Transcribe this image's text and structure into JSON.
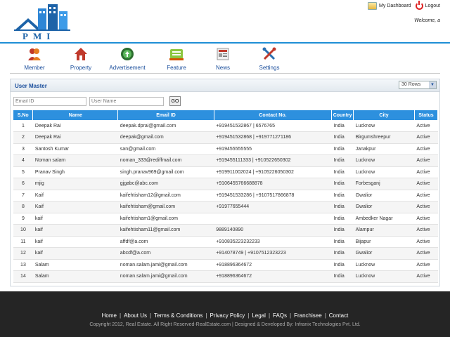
{
  "header": {
    "logo_text": "PMI",
    "dashboard_label": "My Dashboard",
    "logout_label": "Logout",
    "welcome_text": "Welcome, a"
  },
  "nav": [
    {
      "label": "Member",
      "icon": "member-icon"
    },
    {
      "label": "Property",
      "icon": "home-icon"
    },
    {
      "label": "Advertisement",
      "icon": "advertisement-icon"
    },
    {
      "label": "Feature",
      "icon": "feature-icon"
    },
    {
      "label": "News",
      "icon": "news-icon"
    },
    {
      "label": "Settings",
      "icon": "settings-icon"
    }
  ],
  "panel": {
    "title": "User Master",
    "rows_select": "30 Rows",
    "email_placeholder": "Email ID",
    "username_placeholder": "User Name",
    "go_label": "GO"
  },
  "table": {
    "headers": [
      "S.No",
      "Name",
      "Email ID",
      "Contact No.",
      "Country",
      "City",
      "Status"
    ],
    "rows": [
      [
        "1",
        "Deepak Rai",
        "deepak.dprai@gmail.com",
        "+919451532867  |  6576765",
        "India",
        "Lucknow",
        "Active"
      ],
      [
        "2",
        "Deepak Rai",
        "deepak@gmail.com",
        "+919451532868  |  +919771271186",
        "India",
        "Birgumshreepur",
        "Active"
      ],
      [
        "3",
        "Santosh Kumar",
        "san@gmail.com",
        "+919455555555",
        "India",
        "Janakpur",
        "Active"
      ],
      [
        "4",
        "Noman salam",
        "noman_333@rediffmail.com",
        "+919455111333  |  +910522650302",
        "India",
        "Lucknow",
        "Active"
      ],
      [
        "5",
        "Pranav Singh",
        "singh.pranav969@gmail.com",
        "+919911002024  |  +9105226050302",
        "India",
        "Lucknow",
        "Active"
      ],
      [
        "6",
        "mjig",
        "gjgabc@abc.com",
        "+9106455766688878",
        "India",
        "Forbesganj",
        "Active"
      ],
      [
        "7",
        "Kaif",
        "kaifehtisham12@gmail.com",
        "+919451533286  |  +9107517866878",
        "India",
        "Gwalior",
        "Active"
      ],
      [
        "8",
        "Kaif",
        "kaifehtisham@gmail.com",
        "+91977655444",
        "India",
        "Gwalior",
        "Active"
      ],
      [
        "9",
        "kaif",
        "kaifehtisham1@gmail.com",
        "",
        "India",
        "Ambedker Nagar",
        "Active"
      ],
      [
        "10",
        "kaif",
        "kaifehtisham11@gmail.com",
        "9889140890",
        "India",
        "Alampur",
        "Active"
      ],
      [
        "11",
        "kaif",
        "affdf@a.com",
        "+910835223232233",
        "India",
        "Bijapur",
        "Active"
      ],
      [
        "12",
        "kaif",
        "abcdf@a.com",
        "+914078749  |  +9107512323223",
        "India",
        "Gwalior",
        "Active"
      ],
      [
        "13",
        "Salam",
        "noman.salam.jami@gmail.com",
        "+918896364672",
        "India",
        "Lucknow",
        "Active"
      ],
      [
        "14",
        "Salam",
        "noman.salam.jami@gmail.com",
        "+918896364672",
        "India",
        "Lucknow",
        "Active"
      ]
    ]
  },
  "footer": {
    "links": [
      "Home",
      "About Us",
      "Terms & Conditions",
      "Privacy Policy",
      "Legal",
      "FAQs",
      "Franchisee",
      "Contact"
    ],
    "copyright": "Copyright 2012, Real Estate. All Right Reserved-RealEstate.com | Designed & Developed By:  Infranix Technologies Pvt. Ltd."
  },
  "colors": {
    "accent": "#2d90de",
    "nav_text": "#1a4e9c",
    "footer_bg": "#252525"
  }
}
